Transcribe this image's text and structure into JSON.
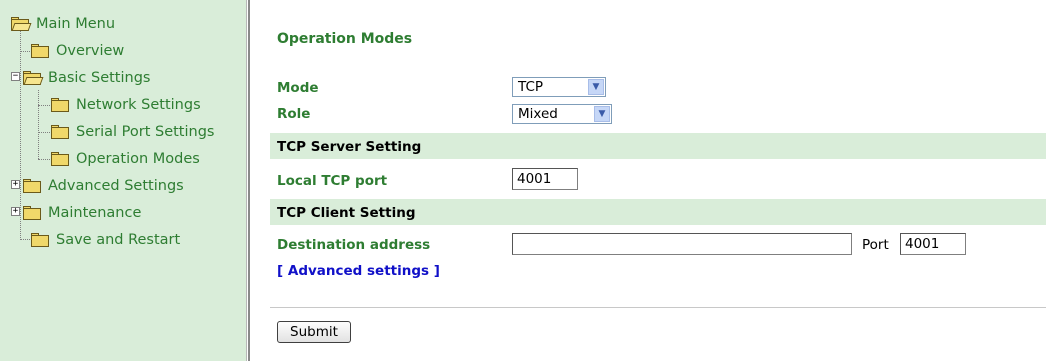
{
  "sidebar": {
    "items": [
      {
        "label": "Main Menu",
        "icon": "folder-open-icon"
      },
      {
        "label": "Overview",
        "icon": "folder-icon"
      },
      {
        "label": "Basic Settings",
        "icon": "folder-open-icon",
        "expander": "−"
      },
      {
        "label": "Network Settings",
        "icon": "folder-icon"
      },
      {
        "label": "Serial Port Settings",
        "icon": "folder-icon"
      },
      {
        "label": "Operation Modes",
        "icon": "folder-icon"
      },
      {
        "label": "Advanced Settings",
        "icon": "folder-icon",
        "expander": "+"
      },
      {
        "label": "Maintenance",
        "icon": "folder-icon",
        "expander": "+"
      },
      {
        "label": "Save and Restart",
        "icon": "folder-icon"
      }
    ]
  },
  "main": {
    "title": "Operation Modes",
    "mode": {
      "label": "Mode",
      "value": "TCP"
    },
    "role": {
      "label": "Role",
      "value": "Mixed"
    },
    "tcp_server": {
      "section_label": "TCP Server Setting",
      "local_port_label": "Local TCP port",
      "local_port_value": "4001"
    },
    "tcp_client": {
      "section_label": "TCP Client Setting",
      "destination_label": "Destination address",
      "destination_value": "",
      "port_label": "Port",
      "port_value": "4001"
    },
    "advanced_link": "[ Advanced settings ]",
    "submit_label": "Submit"
  },
  "colors": {
    "sidebar_bg": "#d9edd9",
    "label_green": "#2e7d32",
    "link_blue": "#1010c8",
    "band_bg": "#d9edd9"
  }
}
